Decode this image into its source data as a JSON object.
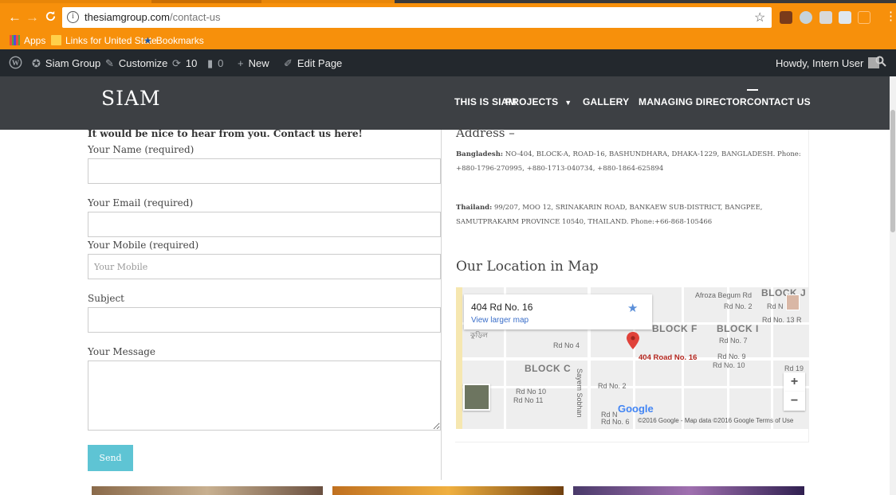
{
  "browser": {
    "url_domain": "thesiamgroup.com",
    "url_path": "/contact-us",
    "info_icon": "i",
    "bookmarks": {
      "apps_label": "Apps",
      "folder_label": "Links for United State",
      "bookmarks_label": "Bookmarks"
    },
    "colors": {
      "chrome_bg": "#f7900b"
    }
  },
  "adminbar": {
    "site_name": "Siam Group",
    "customize": "Customize",
    "updates_count": "10",
    "comments_count": "0",
    "new_label": "New",
    "edit_page": "Edit Page",
    "howdy": "Howdy, Intern User"
  },
  "site": {
    "logo": "SIAM",
    "nav": [
      {
        "label": "THIS IS SIAM"
      },
      {
        "label": "PROJECTS"
      },
      {
        "label": "GALLERY"
      },
      {
        "label": "MANAGING DIRECTOR"
      },
      {
        "label": "CONTACT US"
      }
    ]
  },
  "form": {
    "intro": "It would be nice to hear from you. Contact us here!",
    "name_label": "Your Name (required)",
    "email_label": "Your Email (required)",
    "mobile_label": "Your Mobile (required)",
    "mobile_placeholder": "Your Mobile",
    "subject_label": "Subject",
    "message_label": "Your Message",
    "send_label": "Send",
    "colors": {
      "send_bg": "#5ec4d4"
    }
  },
  "address": {
    "title": "Address –",
    "bd_label": "Bangladesh:",
    "bd_text": " NO-404, BLOCK-A, ROAD-16, BASHUNDHARA, DHAKA-1229, BANGLADESH. Phone: +880-1796-270995, +880-1713-040734, +880-1864-625894",
    "th_label": "Thailand:",
    "th_text": " 99/207, MOO 12, SRINAKARIN ROAD, BANKAEW SUB-DISTRICT, BANGPEE, SAMUTPRAKARM PROVINCE 10540, THAILAND. Phone:+66-868-105466"
  },
  "map": {
    "title": "Our Location in Map",
    "card_title": "404 Rd No. 16",
    "card_link": "View larger map",
    "pin_label": "404 Road No. 16",
    "footer": "©2016 Google - Map data ©2016 Google   Terms of Use",
    "google_logo": "Google",
    "zoom_in": "+",
    "zoom_out": "−",
    "labels": {
      "afroza": "Afroza Begum Rd",
      "block_j": "BLOCK J",
      "rd2_top": "Rd No. 2",
      "rdn": "Rd N",
      "rd13": "Rd No. 13 R",
      "block_f": "BLOCK F",
      "block_i": "BLOCK I",
      "rd7": "Rd No. 7",
      "rd4": "Rd No 4",
      "rd9": "Rd No. 9",
      "rd10_r": "Rd No. 10",
      "rd19": "Rd 19",
      "block_c": "BLOCK C",
      "rd2_mid": "Rd No. 2",
      "rd10_l": "Rd No 10",
      "rd11": "Rd No 11",
      "sayem": "Sayem Sobhan",
      "rdn_bottom": "Rd N",
      "rd6": "Rd No. 6",
      "bengali": "কুড়িল"
    }
  }
}
